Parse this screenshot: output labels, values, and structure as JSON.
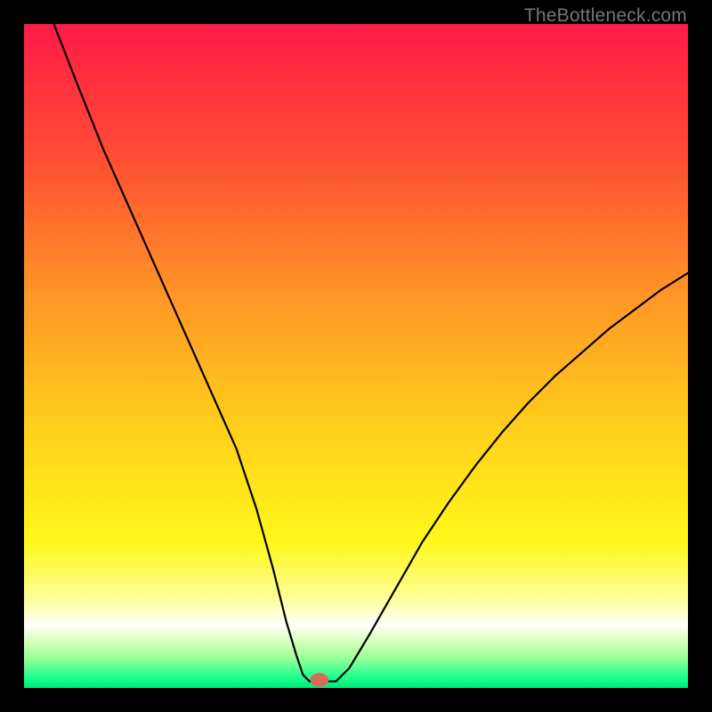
{
  "watermark": "TheBottleneck.com",
  "chart_data": {
    "type": "line",
    "title": "",
    "xlabel": "",
    "ylabel": "",
    "xlim": [
      0,
      100
    ],
    "ylim": [
      0,
      100
    ],
    "grid": false,
    "legend": false,
    "background_gradient_stops": [
      {
        "pos": 0.0,
        "color": "#ff1a47"
      },
      {
        "pos": 0.2,
        "color": "#ff4d33"
      },
      {
        "pos": 0.42,
        "color": "#ff9926"
      },
      {
        "pos": 0.62,
        "color": "#ffd21a"
      },
      {
        "pos": 0.78,
        "color": "#fff71a"
      },
      {
        "pos": 0.87,
        "color": "#fdffa0"
      },
      {
        "pos": 0.905,
        "color": "#ffffff"
      },
      {
        "pos": 0.93,
        "color": "#d6ffb8"
      },
      {
        "pos": 0.955,
        "color": "#99ff99"
      },
      {
        "pos": 0.985,
        "color": "#1aff8c"
      },
      {
        "pos": 1.0,
        "color": "#00e676"
      }
    ],
    "series": [
      {
        "name": "bottleneck-curve",
        "color": "#000000",
        "x": [
          4.5,
          8,
          12,
          16,
          20,
          24,
          28,
          32,
          35,
          37.5,
          39.5,
          41,
          42,
          43,
          45,
          47,
          49,
          52,
          56,
          60,
          64,
          68,
          72,
          76,
          80,
          84,
          88,
          92,
          96,
          100
        ],
        "y": [
          100,
          91,
          81,
          72,
          63,
          54,
          45,
          36,
          27,
          18,
          10,
          5,
          2,
          1,
          1,
          1,
          3,
          8,
          15,
          22,
          28,
          33.5,
          38.5,
          43,
          47,
          50.5,
          54,
          57,
          60,
          62.5
        ]
      }
    ],
    "marker": {
      "name": "optimal-point",
      "x": 44.5,
      "y": 1.2,
      "rx": 1.4,
      "ry": 1.05,
      "color": "#d66a5c"
    }
  }
}
